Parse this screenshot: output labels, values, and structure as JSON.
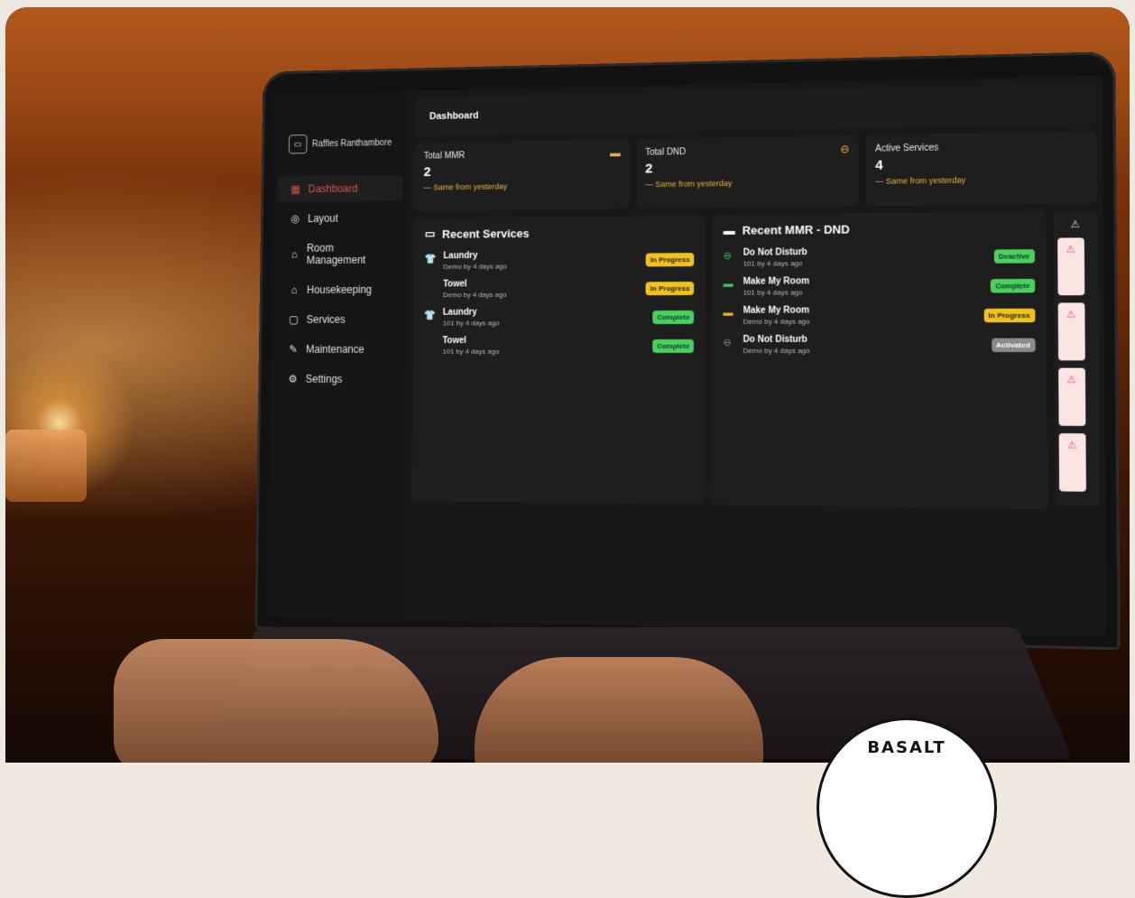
{
  "app": {
    "hotel_name": "Raffles Ranthambore"
  },
  "sidebar": {
    "items": [
      {
        "label": "Dashboard",
        "icon": "dashboard-icon",
        "active": true
      },
      {
        "label": "Layout",
        "icon": "layout-icon"
      },
      {
        "label": "Room Management",
        "icon": "room-icon"
      },
      {
        "label": "Housekeeping",
        "icon": "housekeeping-icon"
      },
      {
        "label": "Services",
        "icon": "chat-icon"
      },
      {
        "label": "Maintenance",
        "icon": "wrench-icon"
      },
      {
        "label": "Settings",
        "icon": "gear-icon"
      }
    ]
  },
  "header": {
    "title": "Dashboard"
  },
  "stats": [
    {
      "title": "Total MMR",
      "value": "2",
      "sub": "— Same from yesterday",
      "icon": "bed-icon"
    },
    {
      "title": "Total DND",
      "value": "2",
      "sub": "— Same from yesterday",
      "icon": "minus-circle-icon"
    },
    {
      "title": "Active Services",
      "value": "4",
      "sub": "— Same from yesterday",
      "icon": ""
    }
  ],
  "recent_services": {
    "title": "Recent Services",
    "rows": [
      {
        "name": "Laundry",
        "sub": "Demo by 4 days ago",
        "status": "In Progress"
      },
      {
        "name": "Towel",
        "sub": "Demo by 4 days ago",
        "status": "In Progress"
      },
      {
        "name": "Laundry",
        "sub": "101 by 4 days ago",
        "status": "Complete"
      },
      {
        "name": "Towel",
        "sub": "101 by 4 days ago",
        "status": "Complete"
      }
    ]
  },
  "recent_mmr": {
    "title": "Recent MMR - DND",
    "rows": [
      {
        "name": "Do Not Disturb",
        "sub": "101 by 4 days ago",
        "status": "Deactive"
      },
      {
        "name": "Make My Room",
        "sub": "101 by 4 days ago",
        "status": "Complete"
      },
      {
        "name": "Make My Room",
        "sub": "Demo by 4 days ago",
        "status": "In Progress"
      },
      {
        "name": "Do Not Disturb",
        "sub": "Demo by 4 days ago",
        "status": "Activated"
      }
    ]
  },
  "seal": {
    "text": "BASALT"
  },
  "colors": {
    "accent": "#e8b43a",
    "active_nav": "#d9544a",
    "complete": "#4ad15d",
    "progress": "#f1c21b"
  }
}
